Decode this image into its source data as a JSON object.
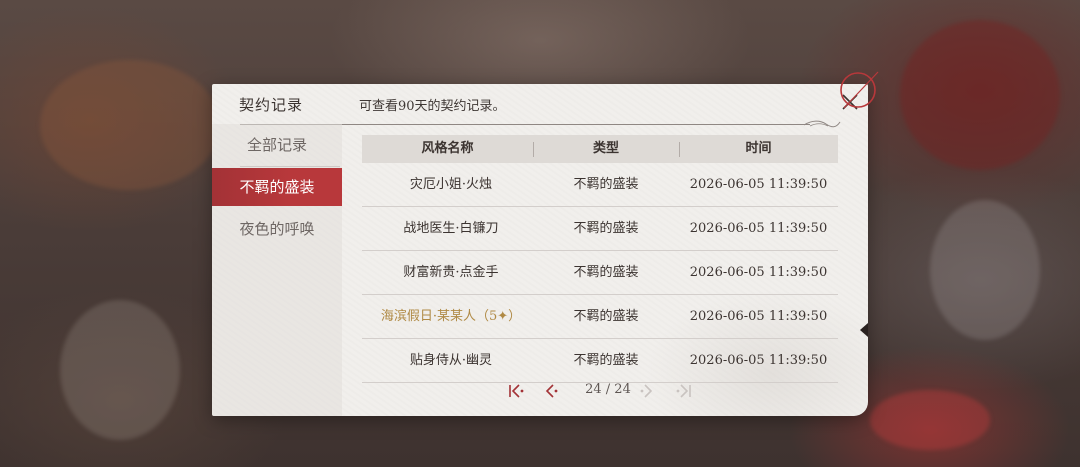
{
  "panel": {
    "title": "契约记录",
    "subtitle": "可查看90天的契约记录。"
  },
  "sidebar": {
    "items": [
      {
        "label": "全部记录",
        "active": false
      },
      {
        "label": "不羁的盛装",
        "active": true
      },
      {
        "label": "夜色的呼唤",
        "active": false
      }
    ]
  },
  "table": {
    "columns": [
      "风格名称",
      "类型",
      "时间"
    ],
    "rows": [
      {
        "name": "灾厄小姐·火烛",
        "type": "不羁的盛装",
        "time": "2026-06-05 11:39:50",
        "highlight": false
      },
      {
        "name": "战地医生·白镰刀",
        "type": "不羁的盛装",
        "time": "2026-06-05 11:39:50",
        "highlight": false
      },
      {
        "name": "财富新贵·点金手",
        "type": "不羁的盛装",
        "time": "2026-06-05 11:39:50",
        "highlight": false
      },
      {
        "name": "海滨假日·某某人（5✦）",
        "type": "不羁的盛装",
        "time": "2026-06-05 11:39:50",
        "highlight": true
      },
      {
        "name": "贴身侍从·幽灵",
        "type": "不羁的盛装",
        "time": "2026-06-05 11:39:50",
        "highlight": false
      }
    ]
  },
  "pager": {
    "page_text": "24 / 24",
    "icons": [
      "first-page-icon",
      "prev-page-icon",
      "next-page-icon",
      "last-page-icon"
    ]
  },
  "colors": {
    "accent": "#b8383b",
    "highlight_text": "#b08a45",
    "panel_bg": "#f1efec"
  }
}
